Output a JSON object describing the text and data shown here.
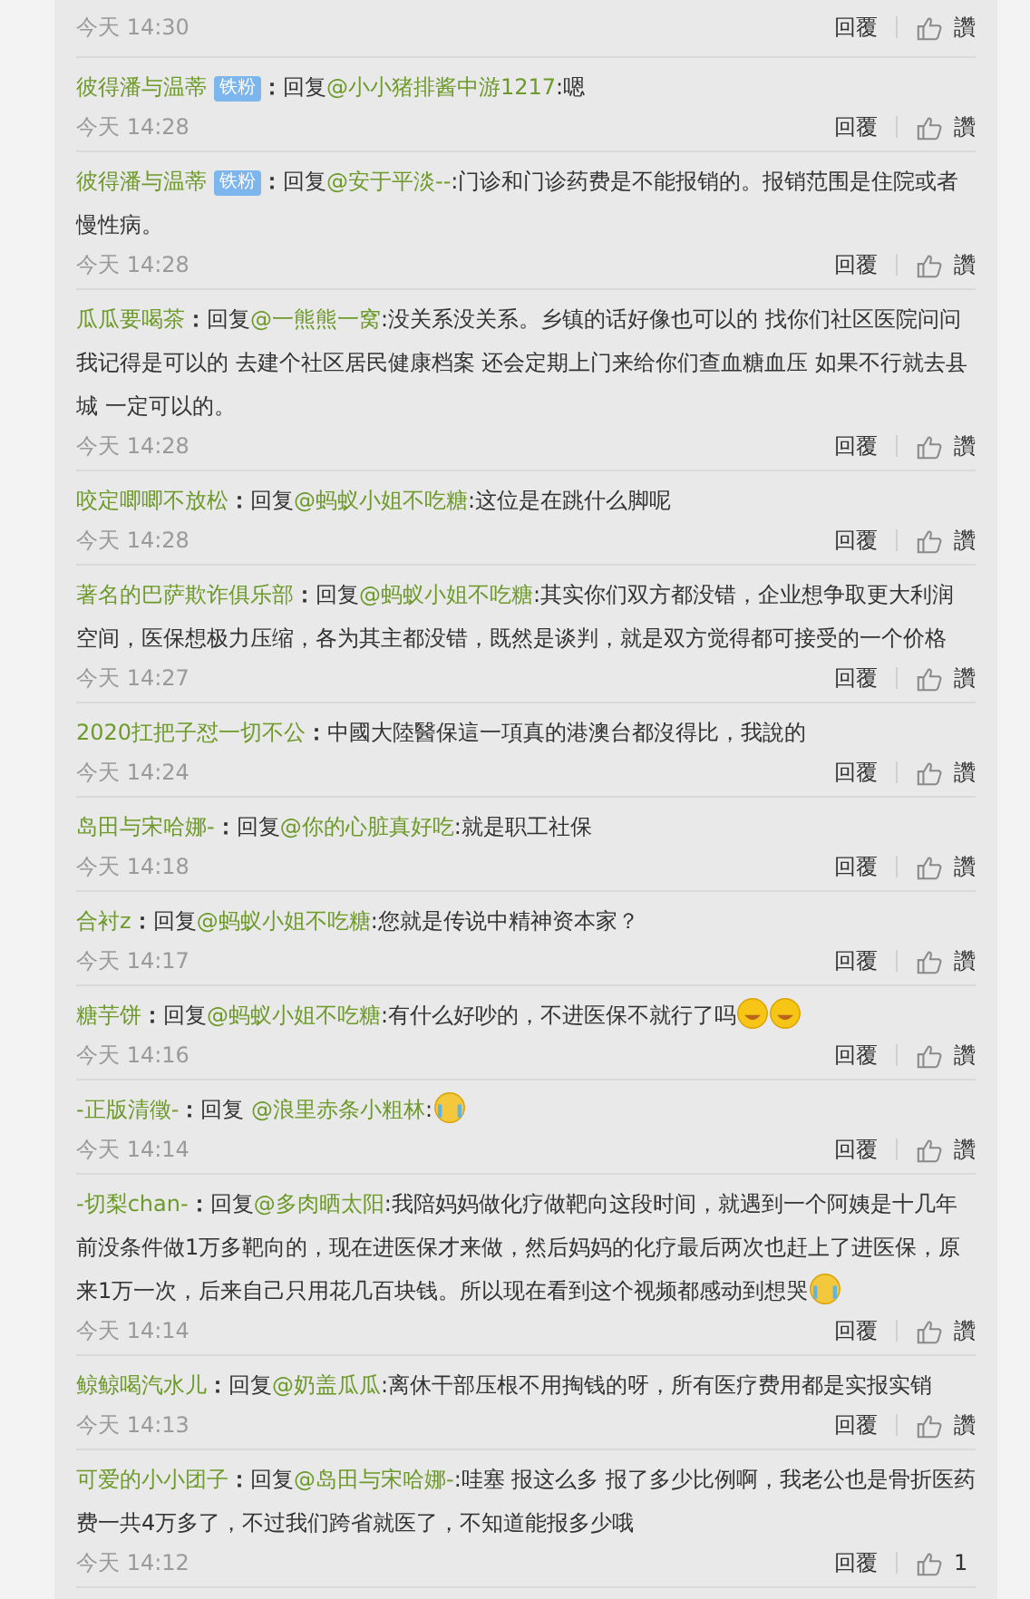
{
  "previous": {
    "time": "今天 14:30",
    "reply_label": "回覆",
    "like_label": "讚"
  },
  "comments": [
    {
      "user": "彼得潘与温蒂",
      "badge": "铁粉",
      "sep": "：",
      "reply": "回复",
      "mention": "@小小猪排酱中游1217",
      "text": ":嗯",
      "time": "今天 14:28",
      "reply_label": "回覆",
      "like_label": "讚"
    },
    {
      "user": "彼得潘与温蒂",
      "badge": "铁粉",
      "sep": "：",
      "reply": "回复",
      "mention": "@安于平淡--",
      "text": ":门诊和门诊药费是不能报销的。报销范围是住院或者慢性病。",
      "time": "今天 14:28",
      "reply_label": "回覆",
      "like_label": "讚"
    },
    {
      "user": "瓜瓜要喝茶",
      "sep": "：",
      "reply": "回复",
      "mention": "@一熊熊一窝",
      "text": ":没关系没关系。乡镇的话好像也可以的 找你们社区医院问问我记得是可以的 去建个社区居民健康档案 还会定期上门来给你们查血糖血压 如果不行就去县城 一定可以的。",
      "time": "今天 14:28",
      "reply_label": "回覆",
      "like_label": "讚"
    },
    {
      "user": "咬定唧唧不放松",
      "sep": "：",
      "reply": "回复",
      "mention": "@蚂蚁小姐不吃糖",
      "text": ":这位是在跳什么脚呢",
      "time": "今天 14:28",
      "reply_label": "回覆",
      "like_label": "讚"
    },
    {
      "user": "著名的巴萨欺诈俱乐部",
      "sep": "：",
      "reply": "回复",
      "mention": "@蚂蚁小姐不吃糖",
      "text": ":其实你们双方都没错，企业想争取更大利润空间，医保想极力压缩，各为其主都没错，既然是谈判，就是双方觉得都可接受的一个价格",
      "time": "今天 14:27",
      "reply_label": "回覆",
      "like_label": "讚"
    },
    {
      "user": "2020扛把子怼一切不公",
      "sep": "：",
      "text": "中國大陸醫保這一項真的港澳台都沒得比，我說的",
      "time": "今天 14:24",
      "reply_label": "回覆",
      "like_label": "讚"
    },
    {
      "user": "岛田与宋哈娜-",
      "sep": "：",
      "reply": "回复",
      "mention": "@你的心脏真好吃",
      "text": ":就是职工社保",
      "time": "今天 14:18",
      "reply_label": "回覆",
      "like_label": "讚"
    },
    {
      "user": "合衬z",
      "sep": "：",
      "reply": "回复",
      "mention": "@蚂蚁小姐不吃糖",
      "text": ":您就是传说中精神资本家？",
      "time": "今天 14:17",
      "reply_label": "回覆",
      "like_label": "讚"
    },
    {
      "user": "糖芋饼",
      "sep": "：",
      "reply": "回复",
      "mention": "@蚂蚁小姐不吃糖",
      "text": ":有什么好吵的，不进医保不就行了吗",
      "emojis": [
        {
          "kind": "grin"
        },
        {
          "kind": "grin"
        }
      ],
      "time": "今天 14:16",
      "reply_label": "回覆",
      "like_label": "讚"
    },
    {
      "user": "-正版清徵-",
      "sep": "：",
      "reply": "回复 ",
      "mention": "@浪里赤条小粗林",
      "text": ":",
      "emojis": [
        {
          "kind": "cry"
        }
      ],
      "time": "今天 14:14",
      "reply_label": "回覆",
      "like_label": "讚"
    },
    {
      "user": "-切梨chan-",
      "sep": "：",
      "reply": "回复",
      "mention": "@多肉晒太阳",
      "text": ":我陪妈妈做化疗做靶向这段时间，就遇到一个阿姨是十几年前没条件做1万多靶向的，现在进医保才来做，然后妈妈的化疗最后两次也赶上了进医保，原来1万一次，后来自己只用花几百块钱。所以现在看到这个视频都感动到想哭",
      "emojis": [
        {
          "kind": "cry"
        }
      ],
      "time": "今天 14:14",
      "reply_label": "回覆",
      "like_label": "讚"
    },
    {
      "user": "鲸鲸喝汽水儿",
      "sep": "：",
      "reply": "回复",
      "mention": "@奶盖瓜瓜",
      "text": ":离休干部压根不用掏钱的呀，所有医疗费用都是实报实销",
      "time": "今天 14:13",
      "reply_label": "回覆",
      "like_label": "讚"
    },
    {
      "user": "可爱的小小团子",
      "sep": "：",
      "reply": "回复",
      "mention": "@岛田与宋哈娜-",
      "text": ":哇塞 报这么多 报了多少比例啊，我老公也是骨折医药费一共4万多了，不过我们跨省就医了，不知道能报多少哦",
      "time": "今天 14:12",
      "reply_label": "回覆",
      "like_label": "1"
    }
  ]
}
